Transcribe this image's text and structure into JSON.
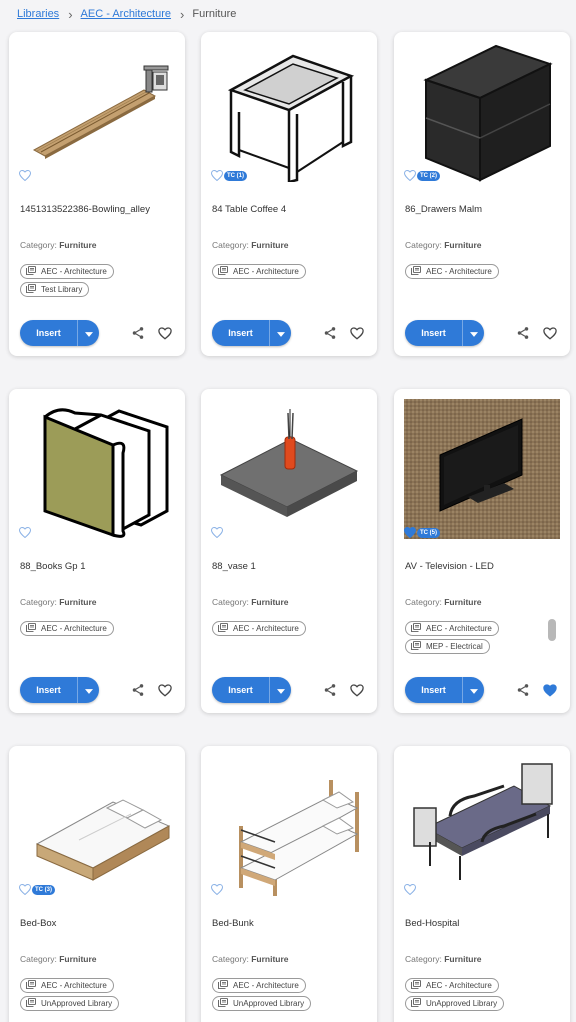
{
  "breadcrumb": {
    "items": [
      "Libraries",
      "AEC - Architecture"
    ],
    "separator": "›",
    "current": "Furniture"
  },
  "labels": {
    "category_prefix": "Category:",
    "insert": "Insert"
  },
  "colors": {
    "accent": "#2f7ad8",
    "text": "#333333"
  },
  "cards": [
    {
      "title": "1451313522386-Bowling_alley",
      "category": "Furniture",
      "tc": null,
      "favorited": false,
      "libraries": [
        "AEC - Architecture",
        "Test Library"
      ],
      "thumbnail_icon": "bowling-alley-thumbnail"
    },
    {
      "title": "84 Table Coffee 4",
      "category": "Furniture",
      "tc": "TC (1)",
      "favorited": false,
      "libraries": [
        "AEC - Architecture"
      ],
      "thumbnail_icon": "coffee-table-thumbnail"
    },
    {
      "title": "86_Drawers Malm",
      "category": "Furniture",
      "tc": "TC (2)",
      "favorited": false,
      "libraries": [
        "AEC - Architecture"
      ],
      "thumbnail_icon": "drawers-thumbnail"
    },
    {
      "title": "88_Books Gp 1",
      "category": "Furniture",
      "tc": null,
      "favorited": false,
      "libraries": [
        "AEC - Architecture"
      ],
      "thumbnail_icon": "books-thumbnail"
    },
    {
      "title": "88_vase 1",
      "category": "Furniture",
      "tc": null,
      "favorited": false,
      "libraries": [
        "AEC - Architecture"
      ],
      "thumbnail_icon": "vase-thumbnail"
    },
    {
      "title": "AV - Television - LED",
      "category": "Furniture",
      "tc": "TC (5)",
      "favorited": true,
      "libraries": [
        "AEC - Architecture",
        "MEP - Electrical"
      ],
      "thumbnail_icon": "television-thumbnail"
    },
    {
      "title": "Bed-Box",
      "category": "Furniture",
      "tc": "TC (3)",
      "favorited": false,
      "libraries": [
        "AEC - Architecture",
        "UnApproved Library"
      ],
      "thumbnail_icon": "bed-box-thumbnail"
    },
    {
      "title": "Bed-Bunk",
      "category": "Furniture",
      "tc": null,
      "favorited": false,
      "libraries": [
        "AEC - Architecture",
        "UnApproved Library"
      ],
      "thumbnail_icon": "bunk-bed-thumbnail"
    },
    {
      "title": "Bed-Hospital",
      "category": "Furniture",
      "tc": null,
      "favorited": false,
      "libraries": [
        "AEC - Architecture",
        "UnApproved Library"
      ],
      "thumbnail_icon": "hospital-bed-thumbnail"
    }
  ]
}
